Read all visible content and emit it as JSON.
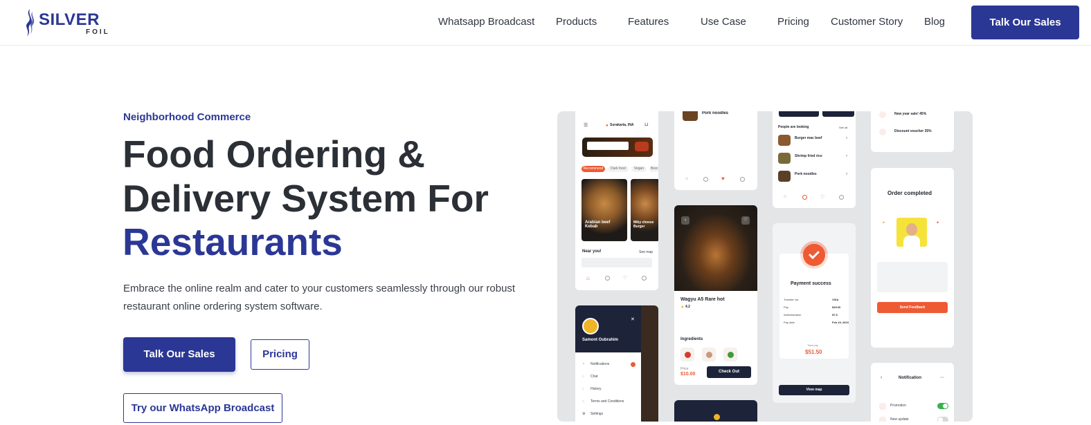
{
  "header": {
    "logo_text": "SILVER",
    "logo_sub": "FOIL",
    "nav": [
      "Whatsapp Broadcast",
      "Products",
      "Features",
      "Use Case",
      "Pricing",
      "Customer Story",
      "Blog"
    ],
    "cta": "Talk Our Sales"
  },
  "hero": {
    "eyebrow": "Neighborhood Commerce",
    "title_line1": "Food Ordering &",
    "title_line2": "Delivery System For",
    "title_line3": "Restaurants",
    "description": "Embrace the online realm and cater to your customers seamlessly through our robust restaurant online ordering system software.",
    "btn_sales": "Talk Our Sales",
    "btn_pricing": "Pricing",
    "btn_whatsapp": "Try our WhatsApp Broadcast"
  },
  "collage": {
    "home": {
      "location": "Surakarta, INA",
      "chips": [
        "Recommend",
        "Dark food",
        "Vegan",
        "Best"
      ],
      "dish1": "Arabian beef Kebab",
      "dish2": "Miky cheese Burger",
      "near": "Near you!",
      "see_map": "See map"
    },
    "noodles": {
      "name": "Pork noodles"
    },
    "looking": {
      "title": "People are looking",
      "see_all": "See all",
      "items": [
        "Burger mac beef",
        "Shrimp fried rice",
        "Pork noodles"
      ]
    },
    "promo": {
      "items": [
        "New year sale! 45%",
        "Discount voucher 35%"
      ]
    },
    "detail": {
      "name": "Wagyu A5 Rare hot",
      "rating": "4.2",
      "ingredients": "Ingredients",
      "price_label": "Price",
      "price": "$10.00",
      "checkout": "Check Out"
    },
    "payment": {
      "status": "Payment success",
      "total_label": "Total pay",
      "total": "$51.50",
      "view_map": "View map",
      "rows": [
        [
          "Transfer via",
          "VISA"
        ],
        [
          "Pay",
          "$49.00"
        ],
        [
          "Administration",
          "$7.5"
        ],
        [
          "Pay date",
          "Feb 19, 2023"
        ]
      ]
    },
    "order": {
      "title": "Order completed",
      "feedback_btn": "Send Feedback"
    },
    "profile": {
      "name": "Samont Oubrahim",
      "menu": [
        "Notifications",
        "Chat",
        "History",
        "Terms and Conditions",
        "Settings"
      ]
    },
    "notification": {
      "title": "Notification",
      "items": [
        "Promotion",
        "New update"
      ]
    },
    "colors": {
      "brand": "#2b3795",
      "accent": "#ee5a33",
      "dark": "#1d2339",
      "toggle_on": "#37b24d"
    }
  }
}
